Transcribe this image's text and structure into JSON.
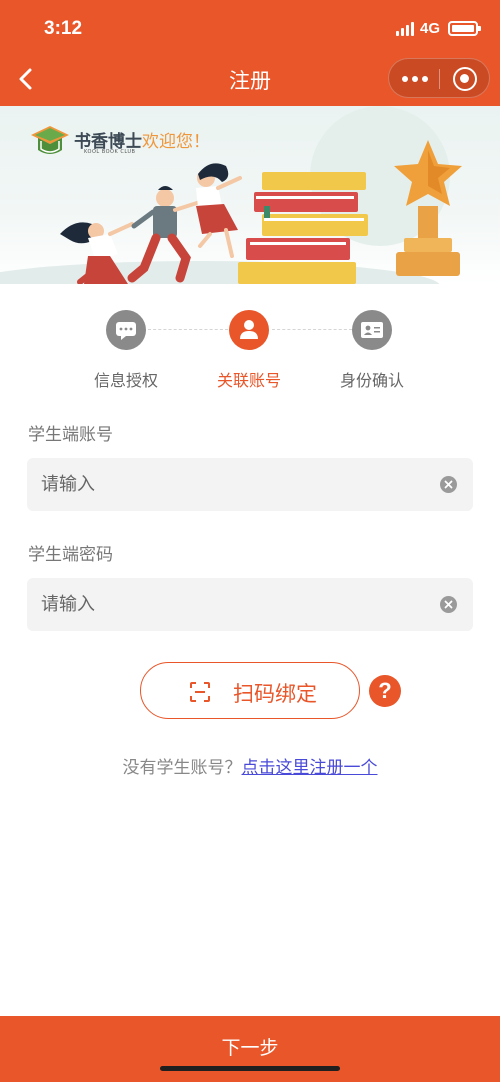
{
  "status_bar": {
    "time": "3:12",
    "network": "4G"
  },
  "nav": {
    "title": "注册"
  },
  "banner": {
    "logo_name": "书香博士",
    "logo_sub": "KOOL BOOK CLUB",
    "welcome": "欢迎您！"
  },
  "steps": [
    {
      "label": "信息授权",
      "icon": "chat-bubble-icon",
      "state": "inactive"
    },
    {
      "label": "关联账号",
      "icon": "user-icon",
      "state": "active"
    },
    {
      "label": "身份确认",
      "icon": "id-card-icon",
      "state": "inactive"
    }
  ],
  "form": {
    "account_label": "学生端账号",
    "account_placeholder": "请输入",
    "account_value": "",
    "password_label": "学生端密码",
    "password_placeholder": "请输入",
    "password_value": ""
  },
  "scan": {
    "label": "扫码绑定",
    "help": "?"
  },
  "register": {
    "prefix": "没有学生账号？",
    "link": "点击这里注册一个"
  },
  "next": {
    "label": "下一步"
  },
  "colors": {
    "accent": "#e8562a",
    "link": "#4a4ad8",
    "field_bg": "#f3f3f3"
  }
}
